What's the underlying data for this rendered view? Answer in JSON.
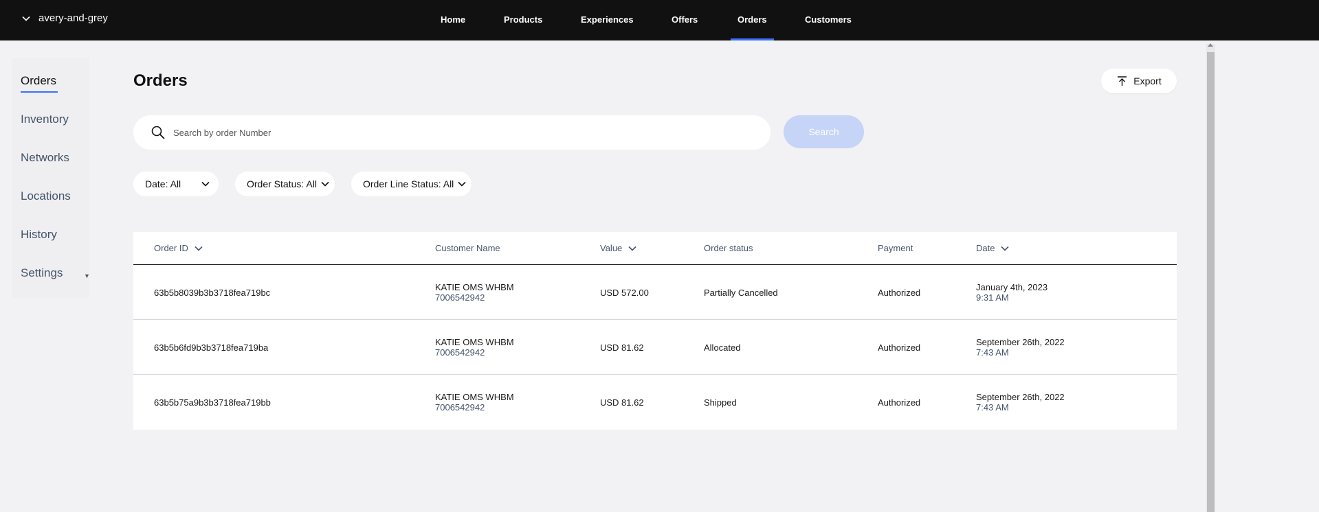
{
  "header": {
    "org_name": "avery-and-grey",
    "nav": [
      {
        "label": "Home"
      },
      {
        "label": "Products"
      },
      {
        "label": "Experiences"
      },
      {
        "label": "Offers"
      },
      {
        "label": "Orders"
      },
      {
        "label": "Customers"
      }
    ],
    "active_nav": "Orders",
    "accent_color": "#3b6ff5"
  },
  "sidebar": {
    "items": [
      {
        "label": "Orders"
      },
      {
        "label": "Inventory"
      },
      {
        "label": "Networks"
      },
      {
        "label": "Locations"
      },
      {
        "label": "History"
      },
      {
        "label": "Settings"
      }
    ],
    "active": "Orders"
  },
  "main": {
    "title": "Orders",
    "export_label": "Export",
    "search": {
      "placeholder": "Search by order Number",
      "value": "",
      "button_label": "Search"
    },
    "filters": [
      {
        "label": "Date: All"
      },
      {
        "label": "Order Status: All"
      },
      {
        "label": "Order Line Status: All"
      }
    ],
    "table": {
      "columns": [
        "Order ID",
        "Customer Name",
        "Value",
        "Order status",
        "Payment",
        "Date"
      ],
      "rows": [
        {
          "order_id": "63b5b8039b3b3718fea719bc",
          "customer_name": "KATIE OMS WHBM",
          "customer_phone": "7006542942",
          "value": "USD 572.00",
          "status": "Partially Cancelled",
          "payment": "Authorized",
          "date": "January 4th, 2023",
          "time": "9:31 AM"
        },
        {
          "order_id": "63b5b6fd9b3b3718fea719ba",
          "customer_name": "KATIE OMS WHBM",
          "customer_phone": "7006542942",
          "value": "USD 81.62",
          "status": "Allocated",
          "payment": "Authorized",
          "date": "September 26th, 2022",
          "time": "7:43 AM"
        },
        {
          "order_id": "63b5b75a9b3b3718fea719bb",
          "customer_name": "KATIE OMS WHBM",
          "customer_phone": "7006542942",
          "value": "USD 81.62",
          "status": "Shipped",
          "payment": "Authorized",
          "date": "September 26th, 2022",
          "time": "7:43 AM"
        }
      ]
    }
  }
}
